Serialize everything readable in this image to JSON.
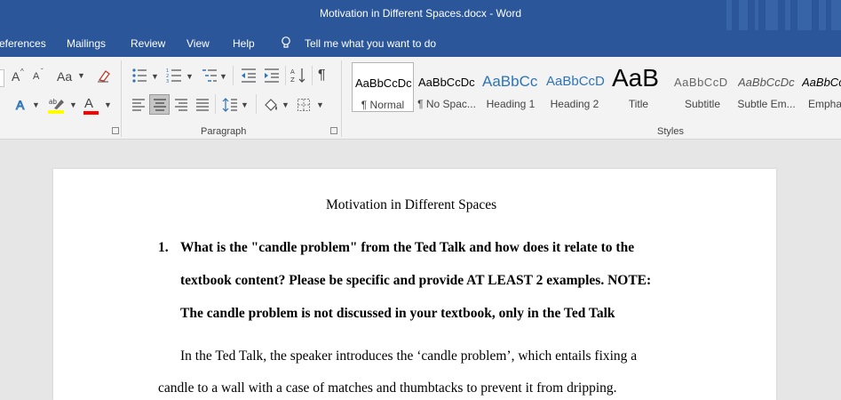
{
  "window": {
    "title": "Motivation in Different Spaces.docx  -  Word"
  },
  "menu": {
    "references": "eferences",
    "mailings": "Mailings",
    "review": "Review",
    "view": "View",
    "help": "Help",
    "tell_me": "Tell me what you want to do"
  },
  "ribbon": {
    "font_group": {
      "grow": "A",
      "shrink": "A",
      "change_case": "Aa",
      "font_color_letter": "A"
    },
    "paragraph_label": "Paragraph",
    "styles_label": "Styles",
    "styles": [
      {
        "preview": "AaBbCcDc",
        "name": "¶ Normal"
      },
      {
        "preview": "AaBbCcDc",
        "name": "¶ No Spac..."
      },
      {
        "preview": "AaBbCc",
        "name": "Heading 1"
      },
      {
        "preview": "AaBbCcD",
        "name": "Heading 2"
      },
      {
        "preview": "AaB",
        "name": "Title"
      },
      {
        "preview": "AaBbCcD",
        "name": "Subtitle"
      },
      {
        "preview": "AaBbCcDc",
        "name": "Subtle Em..."
      },
      {
        "preview": "AaBbCcL",
        "name": "Empha"
      }
    ]
  },
  "document": {
    "title": "Motivation in Different Spaces",
    "q_number": "1.",
    "q_lines": [
      "What is the \"candle problem\" from the Ted Talk and how does it relate to the",
      "textbook content? Please be specific and provide AT LEAST 2 examples. NOTE:",
      "The candle problem is not discussed in your textbook, only in the Ted Talk"
    ],
    "body_lines": [
      "In the Ted Talk, the speaker introduces the ‘candle problem’, which entails fixing a",
      "candle to a wall with a case of matches and thumbtacks to prevent it from dripping."
    ]
  },
  "colors": {
    "word_blue": "#2b579a",
    "heading_blue": "#2e74b5",
    "highlight": "#ffff00",
    "font_red": "#ff0000"
  }
}
